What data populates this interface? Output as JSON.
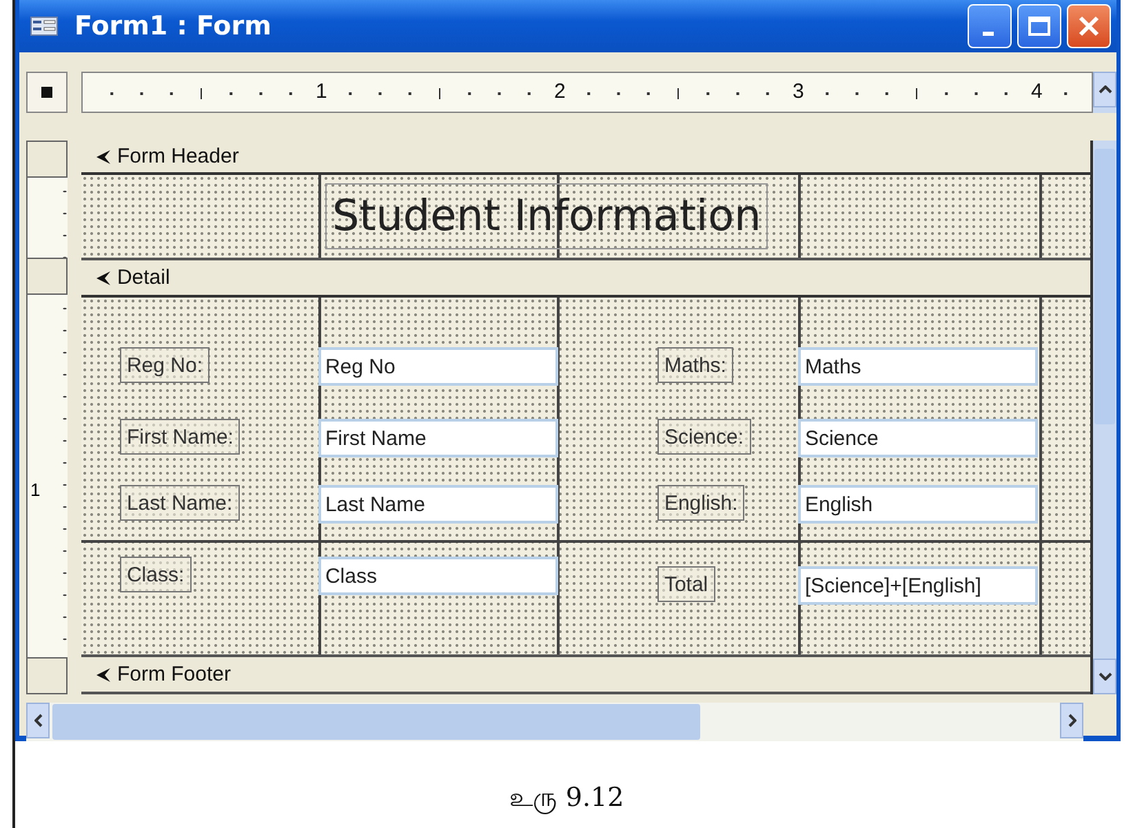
{
  "window": {
    "title": "Form1 : Form"
  },
  "ruler": {
    "numbers": [
      "1",
      "2",
      "3",
      "4"
    ]
  },
  "side_ruler": {
    "number": "1"
  },
  "form_header": {
    "band": "Form Header",
    "title_label": "Student Information"
  },
  "detail": {
    "band": "Detail",
    "left_column": [
      {
        "label": "Reg No:",
        "field": "Reg No"
      },
      {
        "label": "First Name:",
        "field": "First Name"
      },
      {
        "label": "Last Name:",
        "field": "Last Name"
      },
      {
        "label": "Class:",
        "field": "Class"
      }
    ],
    "right_column": [
      {
        "label": "Maths:",
        "field": "Maths"
      },
      {
        "label": "Science:",
        "field": "Science"
      },
      {
        "label": "English:",
        "field": "English"
      },
      {
        "label": "Total",
        "field": "[Science]+[English]"
      }
    ]
  },
  "form_footer": {
    "band": "Form Footer"
  },
  "caption": "உரு 9.12"
}
